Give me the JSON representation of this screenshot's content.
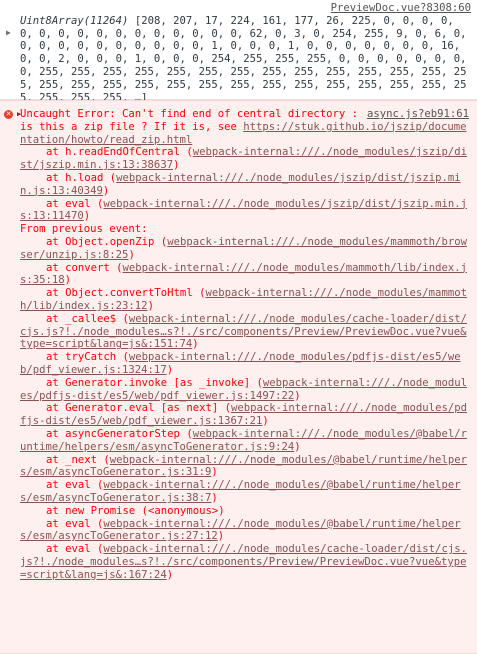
{
  "log": {
    "source": "PreviewDoc.vue?8308:60",
    "array_head": "Uint8Array(11264)",
    "array_body": " [208, 207, 17, 224, 161, 177, 26, 225, 0, 0, 0, 0, 0, 0, 0, 0, 0, 0, 0, 0, 0, 0, 0, 0, 62, 0, 3, 0, 254, 255, 9, 0, 6, 0, 0, 0, 0, 0, 0, 0, 0, 0, 0, 0, 1, 0, 0, 0, 1, 0, 0, 0, 0, 0, 0, 0, 16, 0, 0, 2, 0, 0, 0, 1, 0, 0, 0, 254, 255, 255, 255, 0, 0, 0, 0, 0, 0, 0, 0, 255, 255, 255, 255, 255, 255, 255, 255, 255, 255, 255, 255, 255, 255, 255, 255, 255, 255, 255, 255, 255, 255, 255, 255, 255, 255, 255, 255, 255, 255, 255, …]"
  },
  "error": {
    "source": "async.js?eb91:61",
    "message": "Uncaught Error: Can't find end of central directory : is this a zip file ? If it is, see ",
    "message_link": "https://stuk.github.io/jszip/documentation/howto/read_zip.html",
    "from_previous": "From previous event:",
    "frames": [
      {
        "fn": "at h.readEndOfCentral (",
        "link": "webpack-internal:///./node_modules/jszip/dist/jszip.min.js:13:38637",
        "tail": ")"
      },
      {
        "fn": "at h.load (",
        "link": "webpack-internal:///./node_modules/jszip/dist/jszip.min.js:13:40349",
        "tail": ")"
      },
      {
        "fn": "at eval (",
        "link": "webpack-internal:///./node_modules/jszip/dist/jszip.min.js:13:11470",
        "tail": ")"
      }
    ],
    "frames2": [
      {
        "fn": "at Object.openZip (",
        "link": "webpack-internal:///./node_modules/mammoth/browser/unzip.js:8:25",
        "tail": ")"
      },
      {
        "fn": "at convert (",
        "link": "webpack-internal:///./node_modules/mammoth/lib/index.js:35:18",
        "tail": ")"
      },
      {
        "fn": "at Object.convertToHtml (",
        "link": "webpack-internal:///./node_modules/mammoth/lib/index.js:23:12",
        "tail": ")"
      },
      {
        "fn": "at _callee$ (",
        "link": "webpack-internal:///./node_modules/cache-loader/dist/cjs.js?!./node_modules…s?!./src/components/Preview/PreviewDoc.vue?vue&type=script&lang=js&:151:74",
        "tail": ")"
      },
      {
        "fn": "at tryCatch (",
        "link": "webpack-internal:///./node_modules/pdfjs-dist/es5/web/pdf_viewer.js:1324:17",
        "tail": ")"
      },
      {
        "fn": "at Generator.invoke [as _invoke] (",
        "link": "webpack-internal:///./node_modules/pdfjs-dist/es5/web/pdf_viewer.js:1497:22",
        "tail": ")"
      },
      {
        "fn": "at Generator.eval [as next] (",
        "link": "webpack-internal:///./node_modules/pdfjs-dist/es5/web/pdf_viewer.js:1367:21",
        "tail": ")"
      },
      {
        "fn": "at asyncGeneratorStep (",
        "link": "webpack-internal:///./node_modules/@babel/runtime/helpers/esm/asyncToGenerator.js:9:24",
        "tail": ")"
      },
      {
        "fn": "at _next (",
        "link": "webpack-internal:///./node_modules/@babel/runtime/helpers/esm/asyncToGenerator.js:31:9",
        "tail": ")"
      },
      {
        "fn": "at eval (",
        "link": "webpack-internal:///./node_modules/@babel/runtime/helpers/esm/asyncToGenerator.js:38:7",
        "tail": ")"
      },
      {
        "fn": "at new Promise (<anonymous>)",
        "link": "",
        "tail": ""
      },
      {
        "fn": "at eval (",
        "link": "webpack-internal:///./node_modules/@babel/runtime/helpers/esm/asyncToGenerator.js:27:12",
        "tail": ")"
      },
      {
        "fn": "at eval (",
        "link": "webpack-internal:///./node_modules/cache-loader/dist/cjs.js?!./node_modules…s?!./src/components/Preview/PreviewDoc.vue?vue&type=script&lang=js&:167:24",
        "tail": ")"
      }
    ]
  },
  "colors": {
    "error_text": "#fe0000",
    "error_bg": "#fff0f0",
    "link": "#8a5252",
    "number": "#1c00cf"
  },
  "icons": {
    "expand": "triangle-right-icon",
    "error": "error-circle-icon"
  }
}
